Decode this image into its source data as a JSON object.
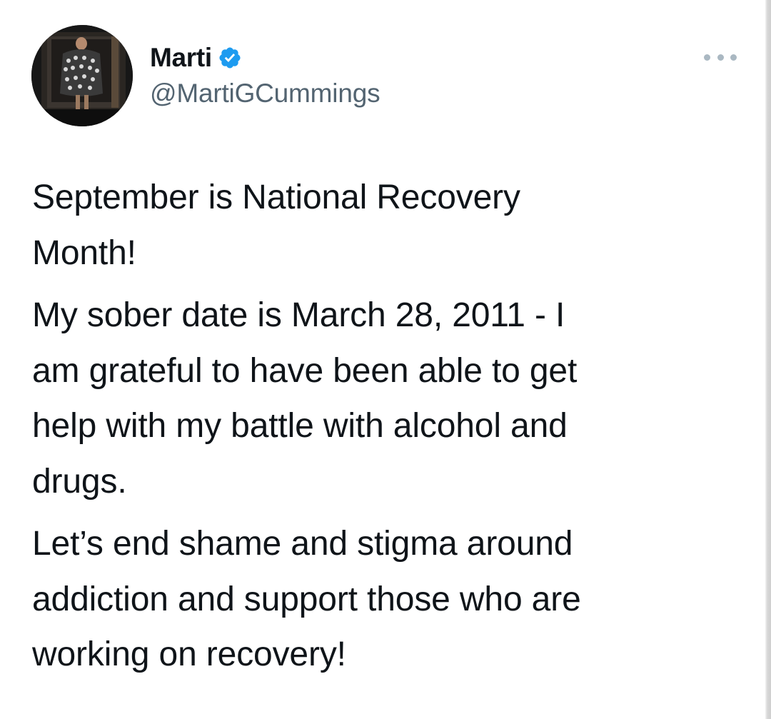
{
  "tweet": {
    "author": {
      "display_name": "Marti",
      "handle": "@MartiGCummings",
      "verified": true,
      "verified_color": "#1d9bf0"
    },
    "paragraphs": [
      {
        "lines": [
          "September is National Recovery",
          "Month!"
        ]
      },
      {
        "lines": [
          "My sober date is March 28, 2011 - I",
          "am grateful to have been able to get",
          "help with my battle with alcohol and",
          "drugs."
        ]
      },
      {
        "lines": [
          "Let’s end shame and stigma around",
          "addiction and support those who are",
          "working on recovery!"
        ]
      }
    ]
  },
  "icons": {
    "verified": "verified-badge-icon",
    "more": "more-options-icon"
  }
}
